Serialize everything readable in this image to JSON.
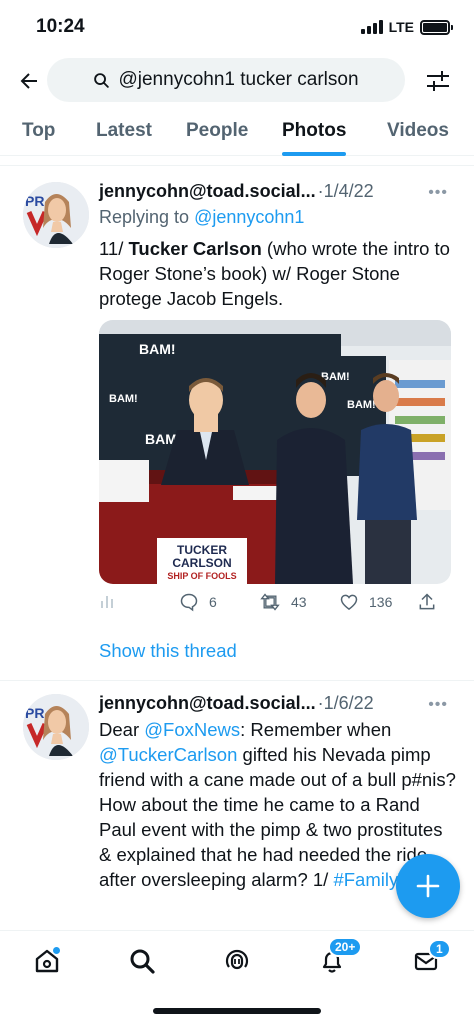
{
  "status": {
    "time": "10:24",
    "network": "LTE"
  },
  "search": {
    "query": "@jennycohn1 tucker carlson"
  },
  "tabs": [
    {
      "label": "Top",
      "active": false
    },
    {
      "label": "Latest",
      "active": false
    },
    {
      "label": "People",
      "active": false
    },
    {
      "label": "Photos",
      "active": true
    },
    {
      "label": "Videos",
      "active": false
    }
  ],
  "tweets": [
    {
      "name": "jennycohn@toad.social...",
      "date": "1/4/22",
      "reply_prefix": "Replying to ",
      "reply_handle": "@jennycohn1",
      "text_1": "11/ ",
      "text_bold": "Tucker Carlson",
      "text_2": " (who wrote the intro to Roger Stone’s book) w/ Roger Stone protege Jacob Engels.",
      "photo": {
        "banner": "BAM!",
        "sign_line1": "TUCKER",
        "sign_line2": "CARLSON",
        "sign_line3": "SHIP OF FOOLS"
      },
      "replies": "6",
      "retweets": "43",
      "likes": "136",
      "show_thread": "Show this thread"
    },
    {
      "name": "jennycohn@toad.social...",
      "date": "1/6/22",
      "t1": "Dear ",
      "m1": "@FoxNews",
      "t2": ": Remember when ",
      "m2": "@TuckerCarlson",
      "t3": " gifted his Nevada pimp friend with a cane made out of a bull p#nis? How about the time he came to a Rand Paul event with the pimp & two prostitutes & explained that he had needed the ride after oversleeping alarm? 1/ ",
      "m3": "#FamilyValues"
    }
  ],
  "nav": {
    "notifications_badge": "20+",
    "messages_badge": "1"
  },
  "colors": {
    "accent": "#1d9bf0",
    "text": "#0f1419",
    "muted": "#536471"
  }
}
